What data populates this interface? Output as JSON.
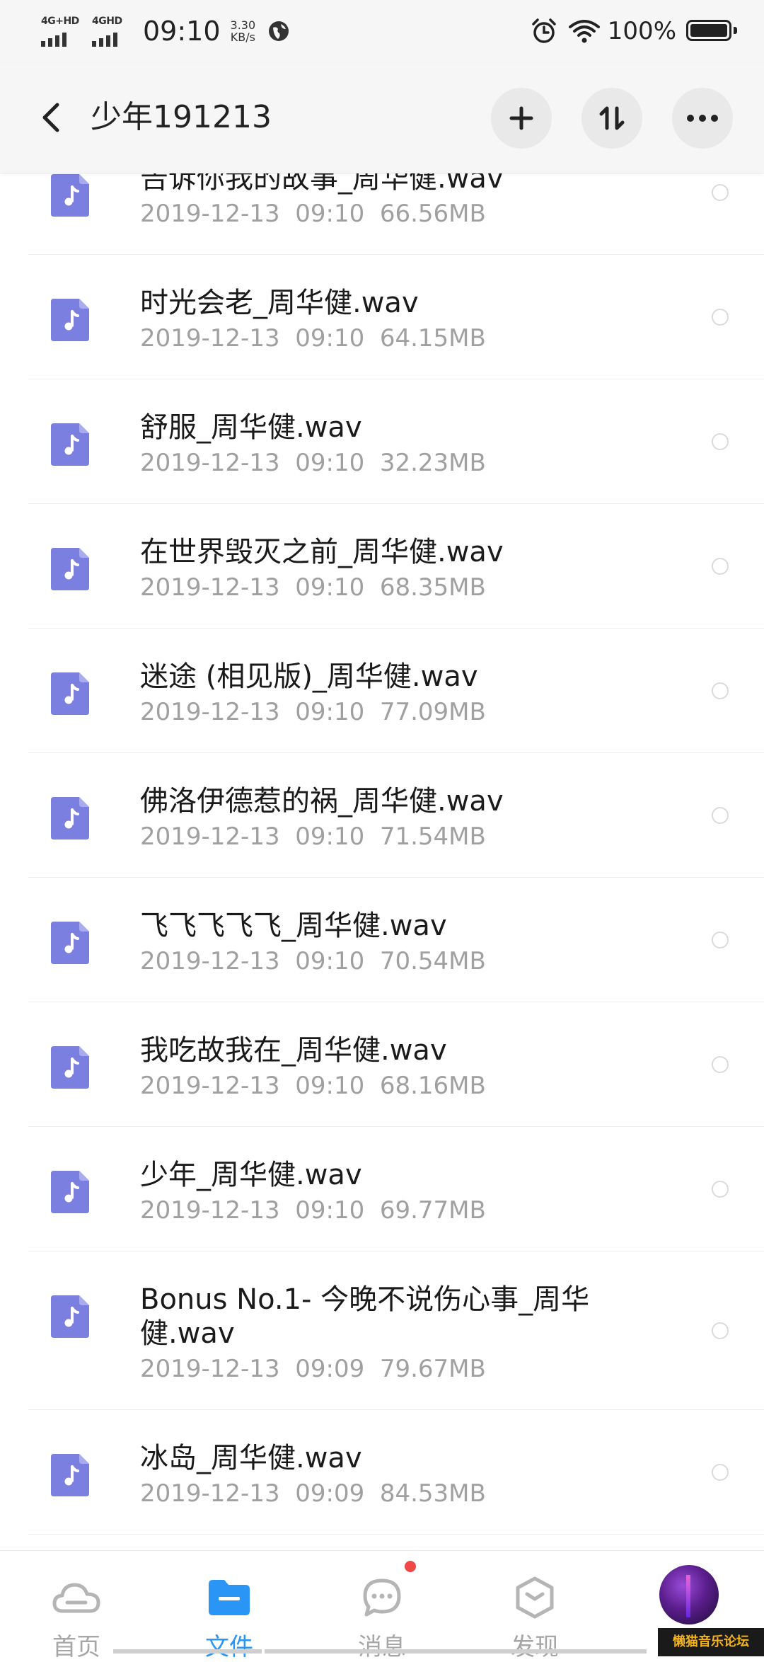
{
  "status_bar": {
    "network_1": "4G+HD",
    "network_2": "4GHD",
    "time": "09:10",
    "speed_value": "3.30",
    "speed_unit": "KB/s",
    "battery": "100%"
  },
  "header": {
    "title": "少年191213",
    "icons": {
      "back": "chevron-left-icon",
      "add": "plus-icon",
      "sort": "sort-icon",
      "more": "more-dots-icon"
    }
  },
  "files": [
    {
      "name": "告诉你我的故事_周华健.wav",
      "date": "2019-12-13",
      "time": "09:10",
      "size": "66.56MB"
    },
    {
      "name": "时光会老_周华健.wav",
      "date": "2019-12-13",
      "time": "09:10",
      "size": "64.15MB"
    },
    {
      "name": "舒服_周华健.wav",
      "date": "2019-12-13",
      "time": "09:10",
      "size": "32.23MB"
    },
    {
      "name": "在世界毁灭之前_周华健.wav",
      "date": "2019-12-13",
      "time": "09:10",
      "size": "68.35MB"
    },
    {
      "name": "迷途 (相见版)_周华健.wav",
      "date": "2019-12-13",
      "time": "09:10",
      "size": "77.09MB"
    },
    {
      "name": "佛洛伊德惹的祸_周华健.wav",
      "date": "2019-12-13",
      "time": "09:10",
      "size": "71.54MB"
    },
    {
      "name": "飞飞飞飞飞_周华健.wav",
      "date": "2019-12-13",
      "time": "09:10",
      "size": "70.54MB"
    },
    {
      "name": "我吃故我在_周华健.wav",
      "date": "2019-12-13",
      "time": "09:10",
      "size": "68.16MB"
    },
    {
      "name": "少年_周华健.wav",
      "date": "2019-12-13",
      "time": "09:10",
      "size": "69.77MB"
    },
    {
      "name": "Bonus No.1- 今晚不说伤心事_周华健.wav",
      "date": "2019-12-13",
      "time": "09:09",
      "size": "79.67MB"
    },
    {
      "name": "冰岛_周华健.wav",
      "date": "2019-12-13",
      "time": "09:09",
      "size": "84.53MB"
    }
  ],
  "file_icon": "music-file-icon",
  "colors": {
    "accent": "#2b95f5",
    "file_icon": "#7b7fe0",
    "badge": "#f04747",
    "meta_text": "#a0a0a0"
  },
  "nav": {
    "items": [
      {
        "label": "首页",
        "icon": "cloud-icon"
      },
      {
        "label": "文件",
        "icon": "folder-icon",
        "active": true
      },
      {
        "label": "消息",
        "icon": "chat-icon",
        "badge": true
      },
      {
        "label": "发现",
        "icon": "discover-icon"
      }
    ],
    "avatar_icon": "avatar"
  },
  "watermark": "懒猫音乐论坛"
}
